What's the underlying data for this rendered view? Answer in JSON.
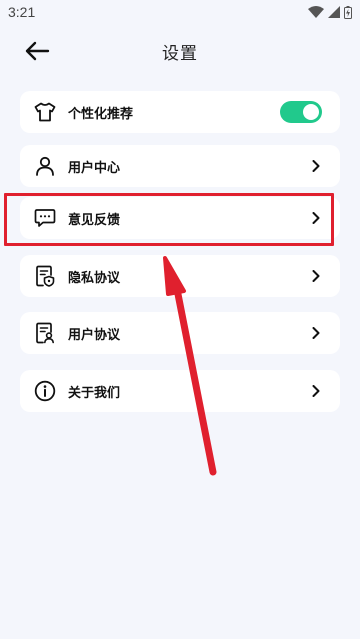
{
  "status_bar": {
    "time": "3:21"
  },
  "header": {
    "title": "设置",
    "back_icon": "arrow-left-icon"
  },
  "settings": {
    "personalized": {
      "label": "个性化推荐",
      "icon": "tshirt-icon",
      "toggle_on": true,
      "accent": "#21c98c"
    },
    "user_center": {
      "label": "用户中心",
      "icon": "person-icon"
    },
    "feedback": {
      "label": "意见反馈",
      "icon": "chat-bubble-icon"
    },
    "privacy": {
      "label": "隐私协议",
      "icon": "shield-document-icon"
    },
    "user_agreement": {
      "label": "用户协议",
      "icon": "user-document-icon"
    },
    "about": {
      "label": "关于我们",
      "icon": "info-icon"
    }
  },
  "annotation": {
    "highlight_color": "#e0202e",
    "target": "feedback"
  }
}
